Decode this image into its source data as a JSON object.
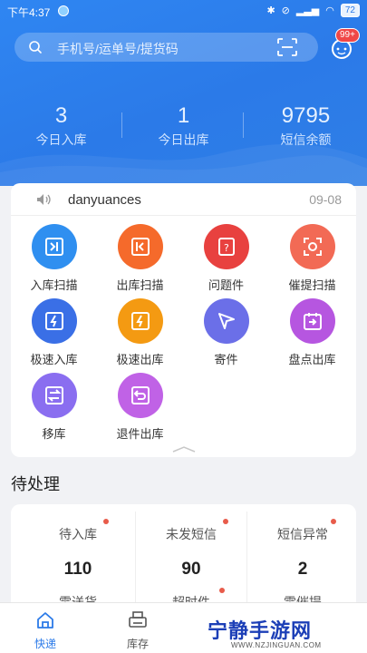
{
  "status_bar": {
    "time": "下午4:37",
    "battery": "72"
  },
  "search": {
    "placeholder": "手机号/运单号/提货码"
  },
  "messages": {
    "badge": "99+"
  },
  "stats": [
    {
      "value": "3",
      "label": "今日入库"
    },
    {
      "value": "1",
      "label": "今日出库"
    },
    {
      "value": "9795",
      "label": "短信余额"
    }
  ],
  "notice": {
    "user": "danyuances",
    "date": "09-08"
  },
  "functions": [
    {
      "label": "入库扫描",
      "icon": "scan-in-icon",
      "color": "#2f8ff0"
    },
    {
      "label": "出库扫描",
      "icon": "scan-out-icon",
      "color": "#f56a2b"
    },
    {
      "label": "问题件",
      "icon": "problem-icon",
      "color": "#e8413f"
    },
    {
      "label": "催提扫描",
      "icon": "remind-scan-icon",
      "color": "#f26a55"
    },
    {
      "label": "极速入库",
      "icon": "fast-in-icon",
      "color": "#3a6fe6"
    },
    {
      "label": "极速出库",
      "icon": "fast-out-icon",
      "color": "#f49a12"
    },
    {
      "label": "寄件",
      "icon": "send-icon",
      "color": "#6b6fe8"
    },
    {
      "label": "盘点出库",
      "icon": "inventory-out-icon",
      "color": "#b656e0"
    },
    {
      "label": "移库",
      "icon": "move-icon",
      "color": "#8a6ef0"
    },
    {
      "label": "退件出库",
      "icon": "return-out-icon",
      "color": "#c062e6"
    }
  ],
  "pending": {
    "title": "待处理",
    "items": [
      {
        "label": "待入库",
        "value": "110"
      },
      {
        "label": "未发短信",
        "value": "90"
      },
      {
        "label": "短信异常",
        "value": "2"
      },
      {
        "label": "需送货",
        "value": ""
      },
      {
        "label": "超时件",
        "value": ""
      },
      {
        "label": "需催提",
        "value": ""
      }
    ]
  },
  "tabs": [
    {
      "label": "快递",
      "active": true
    },
    {
      "label": "库存",
      "active": false
    }
  ],
  "watermark": {
    "text": "宁静手游网",
    "url": "WWW.NZJINGUAN.COM"
  },
  "colors": {
    "primary": "#2b7ae8",
    "badge": "#f04747",
    "dot": "#e85b4a"
  }
}
